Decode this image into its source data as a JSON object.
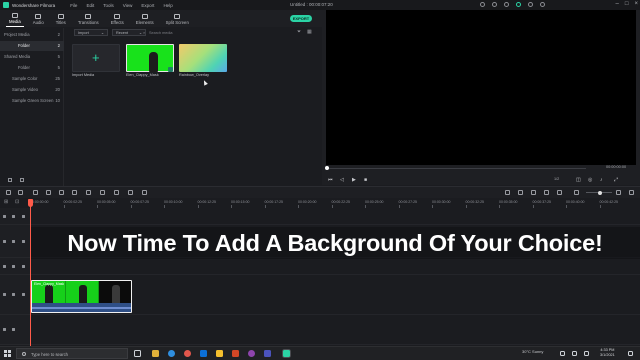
{
  "window": {
    "app_name": "Wondershare Filmora",
    "menu": [
      "File",
      "Edit",
      "Tools",
      "View",
      "Export",
      "Help"
    ],
    "document_title": "Untitled : 00:00:07:20"
  },
  "media_tabs": [
    {
      "label": "Media",
      "icon": "media-folder-icon",
      "active": true
    },
    {
      "label": "Audio",
      "icon": "music-note-icon",
      "active": false
    },
    {
      "label": "Titles",
      "icon": "text-t-icon",
      "active": false
    },
    {
      "label": "Transitions",
      "icon": "transition-icon",
      "active": false
    },
    {
      "label": "Effects",
      "icon": "effects-icon",
      "active": false
    },
    {
      "label": "Elements",
      "icon": "elements-icon",
      "active": false
    },
    {
      "label": "Split Screen",
      "icon": "split-screen-icon",
      "active": false
    }
  ],
  "export_label": "EXPORT",
  "sidebar": {
    "items": [
      {
        "label": "Project Media",
        "count": "2",
        "level": 0,
        "selected": false
      },
      {
        "label": "Folder",
        "count": "2",
        "level": 1,
        "selected": true
      },
      {
        "label": "Shared Media",
        "count": "5",
        "level": 0,
        "selected": false
      },
      {
        "label": "Folder",
        "count": "5",
        "level": 1,
        "selected": false
      },
      {
        "label": "Sample Color",
        "count": "25",
        "level": 1,
        "selected": false
      },
      {
        "label": "Sample Video",
        "count": "20",
        "level": 1,
        "selected": false
      },
      {
        "label": "Sample Green Screen",
        "count": "10",
        "level": 1,
        "selected": false
      }
    ]
  },
  "media_toolbar": {
    "import_dropdown": "Import",
    "sort_dropdown": "Recent",
    "search_placeholder": "Search media"
  },
  "media_items": [
    {
      "caption": "Import Media",
      "kind": "import"
    },
    {
      "caption": "Elen_Clappy_Mask",
      "kind": "green-screen"
    },
    {
      "caption": "Rainbow_Overlay",
      "kind": "gradient"
    }
  ],
  "preview": {
    "timecode": "00:00:00:00",
    "ratio": "1/2"
  },
  "ruler_labels": [
    "00:00:00:00",
    "00:00:02:25",
    "00:00:05:00",
    "00:00:07:25",
    "00:00:10:00",
    "00:00:12:25",
    "00:00:15:00",
    "00:00:17:25",
    "00:00:20:00",
    "00:00:22:25",
    "00:00:25:00",
    "00:00:27:25",
    "00:00:30:00",
    "00:00:32:25",
    "00:00:35:00",
    "00:00:37:25",
    "00:00:40:00",
    "00:00:42:25"
  ],
  "clip": {
    "label": "Elen_Clappy_Mask"
  },
  "overlay_caption": "Now Time To Add A Background Of Your Choice!",
  "taskbar": {
    "search_placeholder": "Type here to search",
    "weather": "30°C  Sunny",
    "time": "4:33 PM",
    "date": "3/1/2021"
  },
  "colors": {
    "accent": "#2bd3a5",
    "green_screen": "#16d01a",
    "playhead": "#ff5b4a"
  }
}
